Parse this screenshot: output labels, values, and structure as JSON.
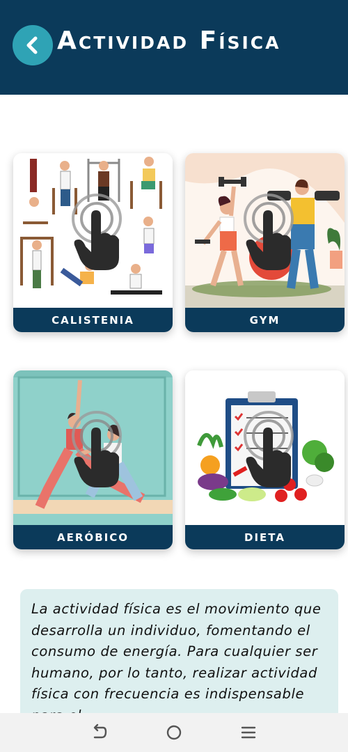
{
  "header": {
    "title": "Actividad Física",
    "back_icon": "chevron-left-icon",
    "background_color": "#0b3a5a",
    "back_button_color": "#2fa3b5"
  },
  "cards": [
    {
      "label": "CALISTENIA",
      "icon": "tap-gesture-icon"
    },
    {
      "label": "GYM",
      "icon": "tap-gesture-icon"
    },
    {
      "label": "AERÓBICO",
      "icon": "tap-gesture-icon"
    },
    {
      "label": "DIETA",
      "icon": "tap-gesture-icon"
    }
  ],
  "description": {
    "text": "La actividad física es el movimiento que desarrolla un individuo, fomentando el consumo de energía. Para cualquier ser humano, por lo tanto, realizar actividad física con frecuencia es indispensable para el"
  },
  "navbar": {
    "icons": [
      "back-nav-icon",
      "home-nav-icon",
      "recents-nav-icon"
    ]
  },
  "colors": {
    "primary": "#0b3a5a",
    "accent": "#2fa3b5",
    "info_bg": "#ddefef"
  }
}
